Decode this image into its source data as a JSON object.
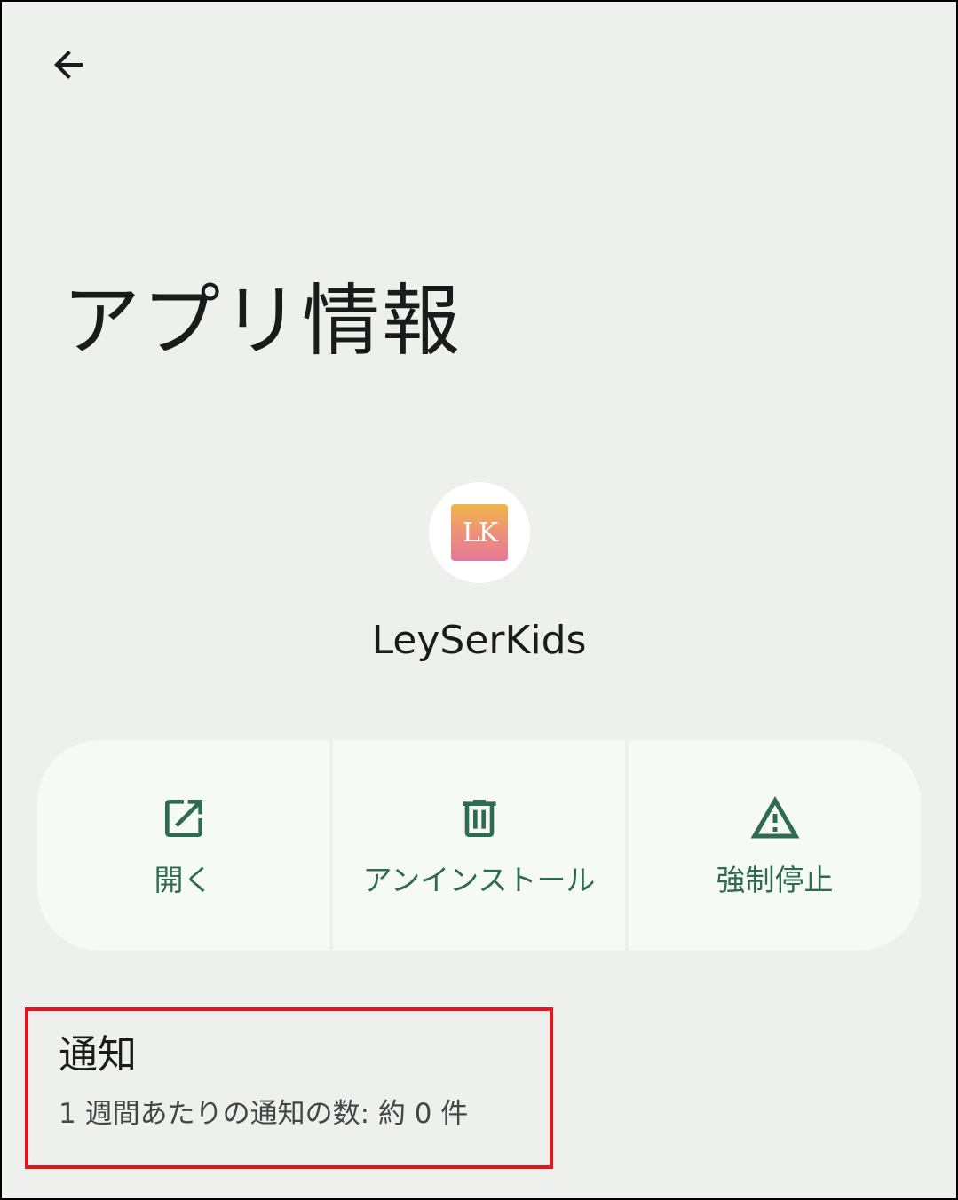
{
  "header": {
    "back_icon": "arrow-back-icon",
    "title": "アプリ情報"
  },
  "app": {
    "icon_text": "LK",
    "icon_colors": [
      "#f1b649",
      "#ec8f7b",
      "#e6799a"
    ],
    "name": "LeySerKids"
  },
  "actions": [
    {
      "icon": "open-in-new-icon",
      "label": "開く"
    },
    {
      "icon": "trash-icon",
      "label": "アンインストール"
    },
    {
      "icon": "warning-icon",
      "label": "強制停止"
    }
  ],
  "notifications": {
    "title": "通知",
    "summary": "1 週間あたりの通知の数: 約 0 件"
  },
  "colors": {
    "background": "#edf0ed",
    "action_bg": "#f6faf5",
    "accent": "#2f6a52",
    "highlight_border": "#e3161f"
  }
}
